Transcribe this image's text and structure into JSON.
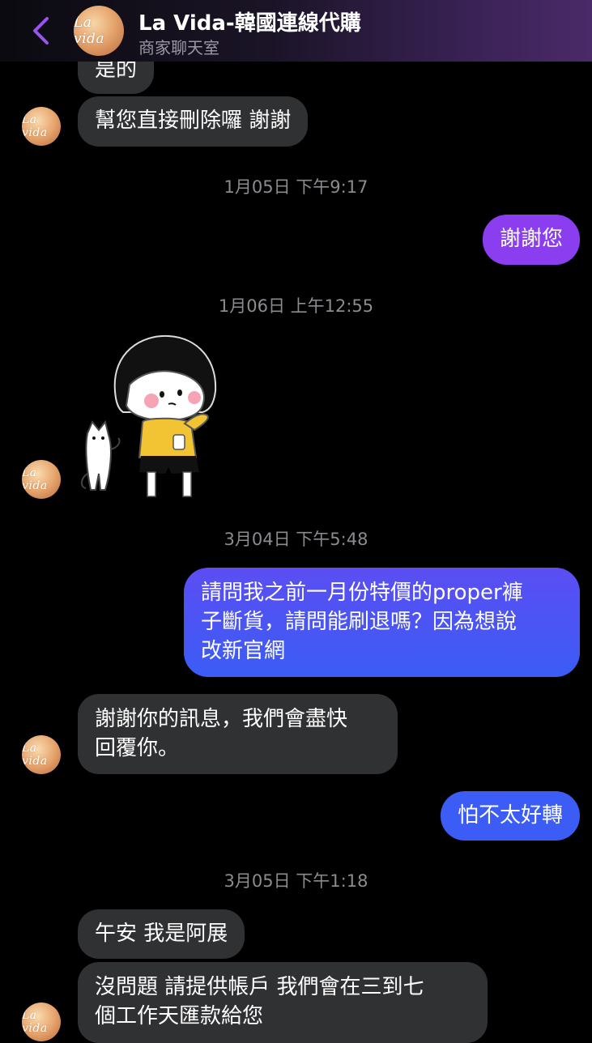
{
  "header": {
    "title": "La Vida-韓國連線代購",
    "subtitle": "商家聊天室",
    "logo_text": "La vida"
  },
  "colors": {
    "outgoing_top": "#8a3ef0",
    "outgoing_bottom": "#3b5cf5",
    "incoming": "#303133",
    "back_icon": "#9a52f0"
  },
  "messages": [
    {
      "type": "in",
      "text": "是的"
    },
    {
      "type": "in",
      "text": "幫您直接刪除囉 謝謝"
    },
    {
      "type": "time",
      "text": "1月05日 下午9:17"
    },
    {
      "type": "out",
      "text": "謝謝您"
    },
    {
      "type": "time",
      "text": "1月06日 上午12:55"
    },
    {
      "type": "sticker",
      "icon": "girl-thinking-with-cat-sticker"
    },
    {
      "type": "time",
      "text": "3月04日 下午5:48"
    },
    {
      "type": "out",
      "text": "請問我之前一月份特價的proper褲\n子斷貨，請問能刷退嗎？因為想說\n改新官網"
    },
    {
      "type": "in",
      "text": "謝謝你的訊息，我們會盡快\n回覆你。"
    },
    {
      "type": "out",
      "text": "怕不太好轉"
    },
    {
      "type": "time",
      "text": "3月05日 下午1:18"
    },
    {
      "type": "in",
      "text": "午安 我是阿展"
    },
    {
      "type": "in",
      "text": "沒問題  請提供帳戶 我們會在三到七\n個工作天匯款給您"
    }
  ]
}
